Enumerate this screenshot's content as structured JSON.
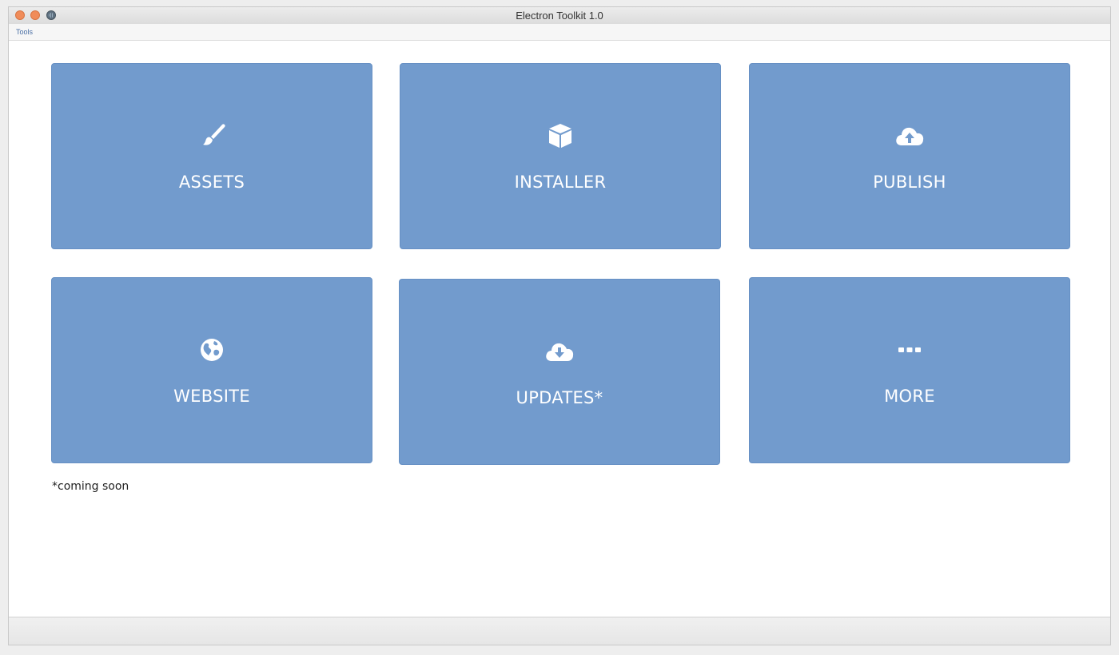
{
  "window": {
    "title": "Electron Toolkit 1.0"
  },
  "menubar": {
    "items": [
      "Tools"
    ]
  },
  "tiles": [
    {
      "label": "ASSETS",
      "icon": "paintbrush-icon"
    },
    {
      "label": "INSTALLER",
      "icon": "cube-icon"
    },
    {
      "label": "PUBLISH",
      "icon": "cloud-upload-icon"
    },
    {
      "label": "WEBSITE",
      "icon": "globe-icon"
    },
    {
      "label": "UPDATES*",
      "icon": "cloud-download-icon"
    },
    {
      "label": "MORE",
      "icon": "ellipsis-icon"
    }
  ],
  "footnote": "*coming soon",
  "colors": {
    "tile": "#729bcd",
    "accent": "#4a6fa5"
  }
}
